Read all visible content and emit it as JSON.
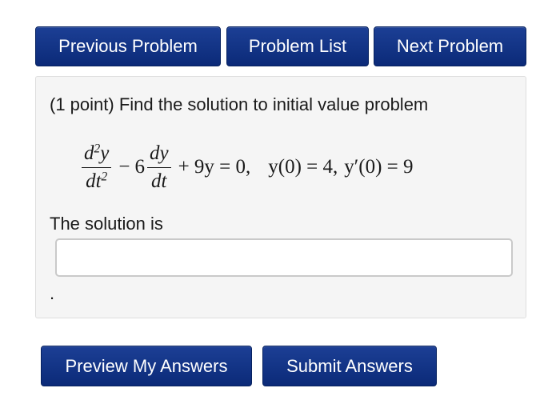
{
  "nav": {
    "previous_label": "Previous Problem",
    "list_label": "Problem List",
    "next_label": "Next Problem"
  },
  "problem": {
    "prompt": "(1 point) Find the solution to initial value problem",
    "equation": {
      "d2y_num": "d",
      "d2y_num_sup": "2",
      "d2y_num_var": "y",
      "d2y_den": "dt",
      "d2y_den_sup": "2",
      "minus": "−",
      "coef_dy": "6",
      "dy_num": "dy",
      "dy_den": "dt",
      "rest": "+ 9y = 0,",
      "ic1": "y(0) = 4,",
      "ic2": "y′(0) = 9"
    },
    "solution_label": "The solution is",
    "answer_value": "",
    "trailing": "."
  },
  "actions": {
    "preview_label": "Preview My Answers",
    "submit_label": "Submit Answers"
  },
  "colors": {
    "button_bg": "#0b2a78",
    "button_text": "#ffffff",
    "panel_bg": "#f5f5f5",
    "panel_border": "#dedede",
    "input_border": "#c9c9c9"
  }
}
